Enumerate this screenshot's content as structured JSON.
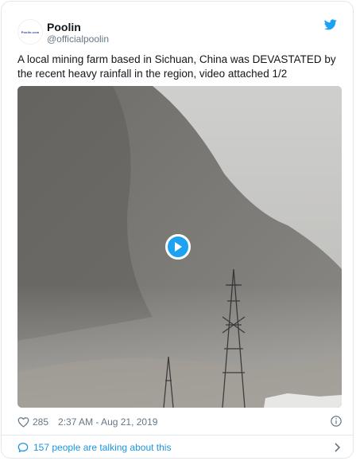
{
  "tweet": {
    "author_name": "Poolin",
    "author_handle": "@officialpoolin",
    "avatar_text": "Poolin.com",
    "text": "A local mining farm based in Sichuan, China was DEVASTATED by the recent heavy rainfall in the region, video attached 1/2",
    "like_count": "285",
    "timestamp": "2:37 AM - Aug 21, 2019",
    "conversation_text": "157 people are talking about this"
  },
  "colors": {
    "accent": "#1da1f2",
    "link": "#1b95e0",
    "muted": "#657786",
    "border": "#e1e8ed"
  },
  "icons": [
    "twitter-bird-icon",
    "play-icon",
    "heart-icon",
    "info-icon",
    "comment-bubble-icon",
    "chevron-right-icon"
  ]
}
